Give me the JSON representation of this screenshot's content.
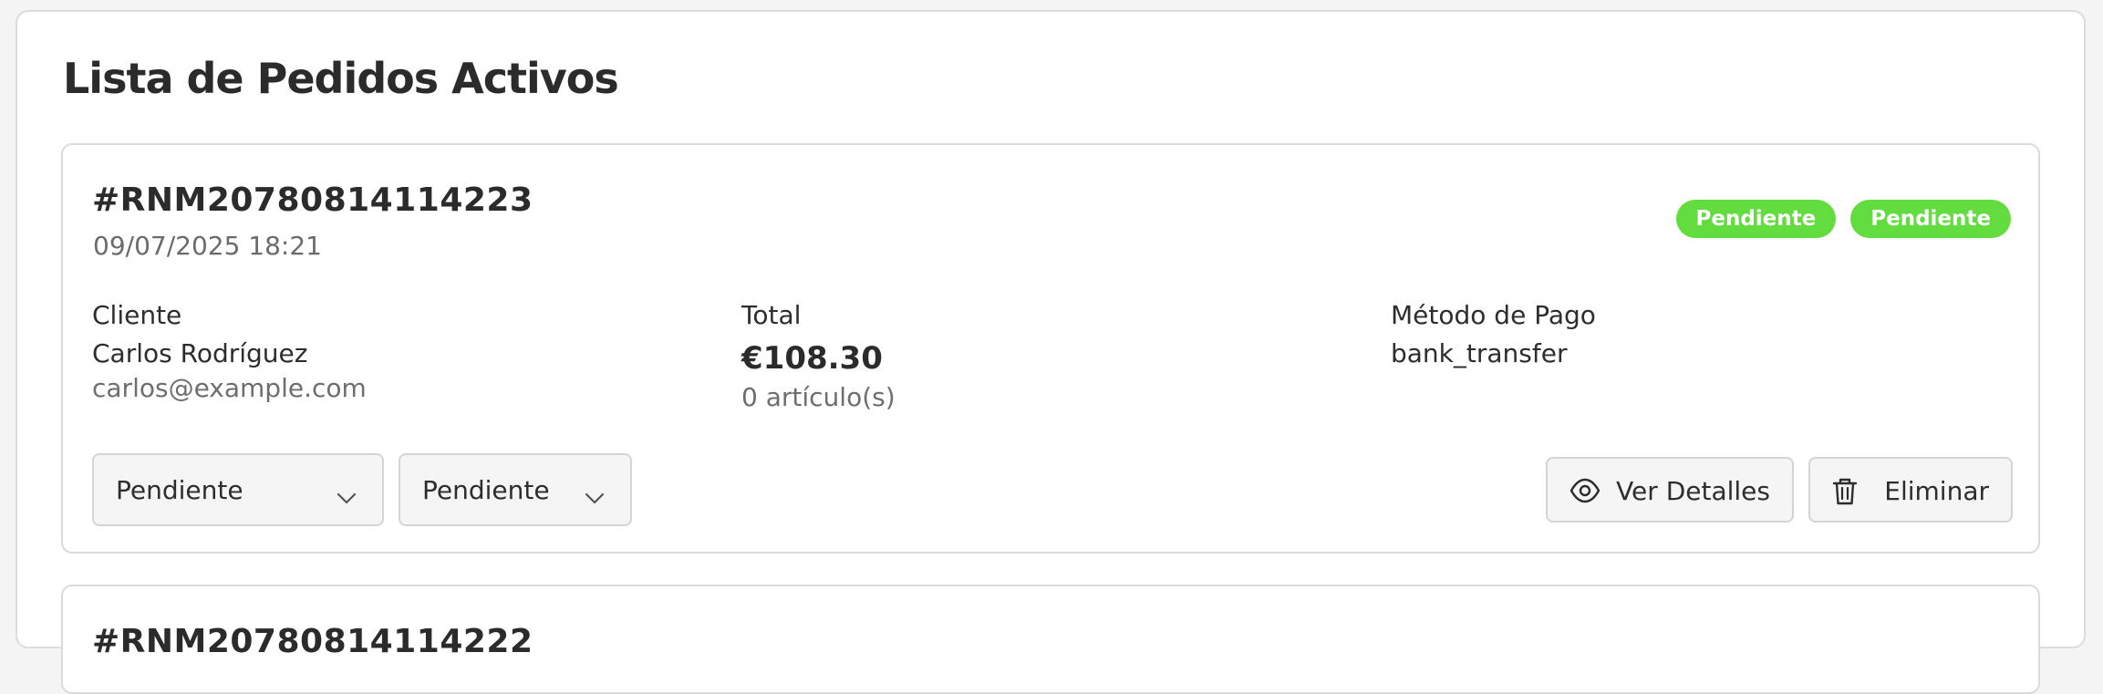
{
  "page": {
    "title": "Lista de Pedidos Activos"
  },
  "colors": {
    "badge_green": "#62dc3f",
    "panel_bg": "#ffffff",
    "button_bg": "#f5f5f5"
  },
  "orders": [
    {
      "id": "#RNM20780814114223",
      "date": "09/07/2025 18:21",
      "badges": [
        "Pendiente",
        "Pendiente"
      ],
      "customer": {
        "label": "Cliente",
        "name": "Carlos Rodríguez",
        "email": "carlos@example.com"
      },
      "total": {
        "label": "Total",
        "amount": "€108.30",
        "items": "0 artículo(s)"
      },
      "payment": {
        "label": "Método de Pago",
        "method": "bank_transfer"
      },
      "status_select": {
        "value": "Pendiente",
        "icon": "chevron-down-icon"
      },
      "payment_select": {
        "value": "Pendiente",
        "icon": "chevron-down-icon"
      },
      "actions": {
        "details": {
          "label": "Ver Detalles",
          "icon": "eye-icon"
        },
        "delete": {
          "label": "Eliminar",
          "icon": "trash-icon"
        }
      }
    },
    {
      "id": "#RNM20780814114222"
    }
  ]
}
